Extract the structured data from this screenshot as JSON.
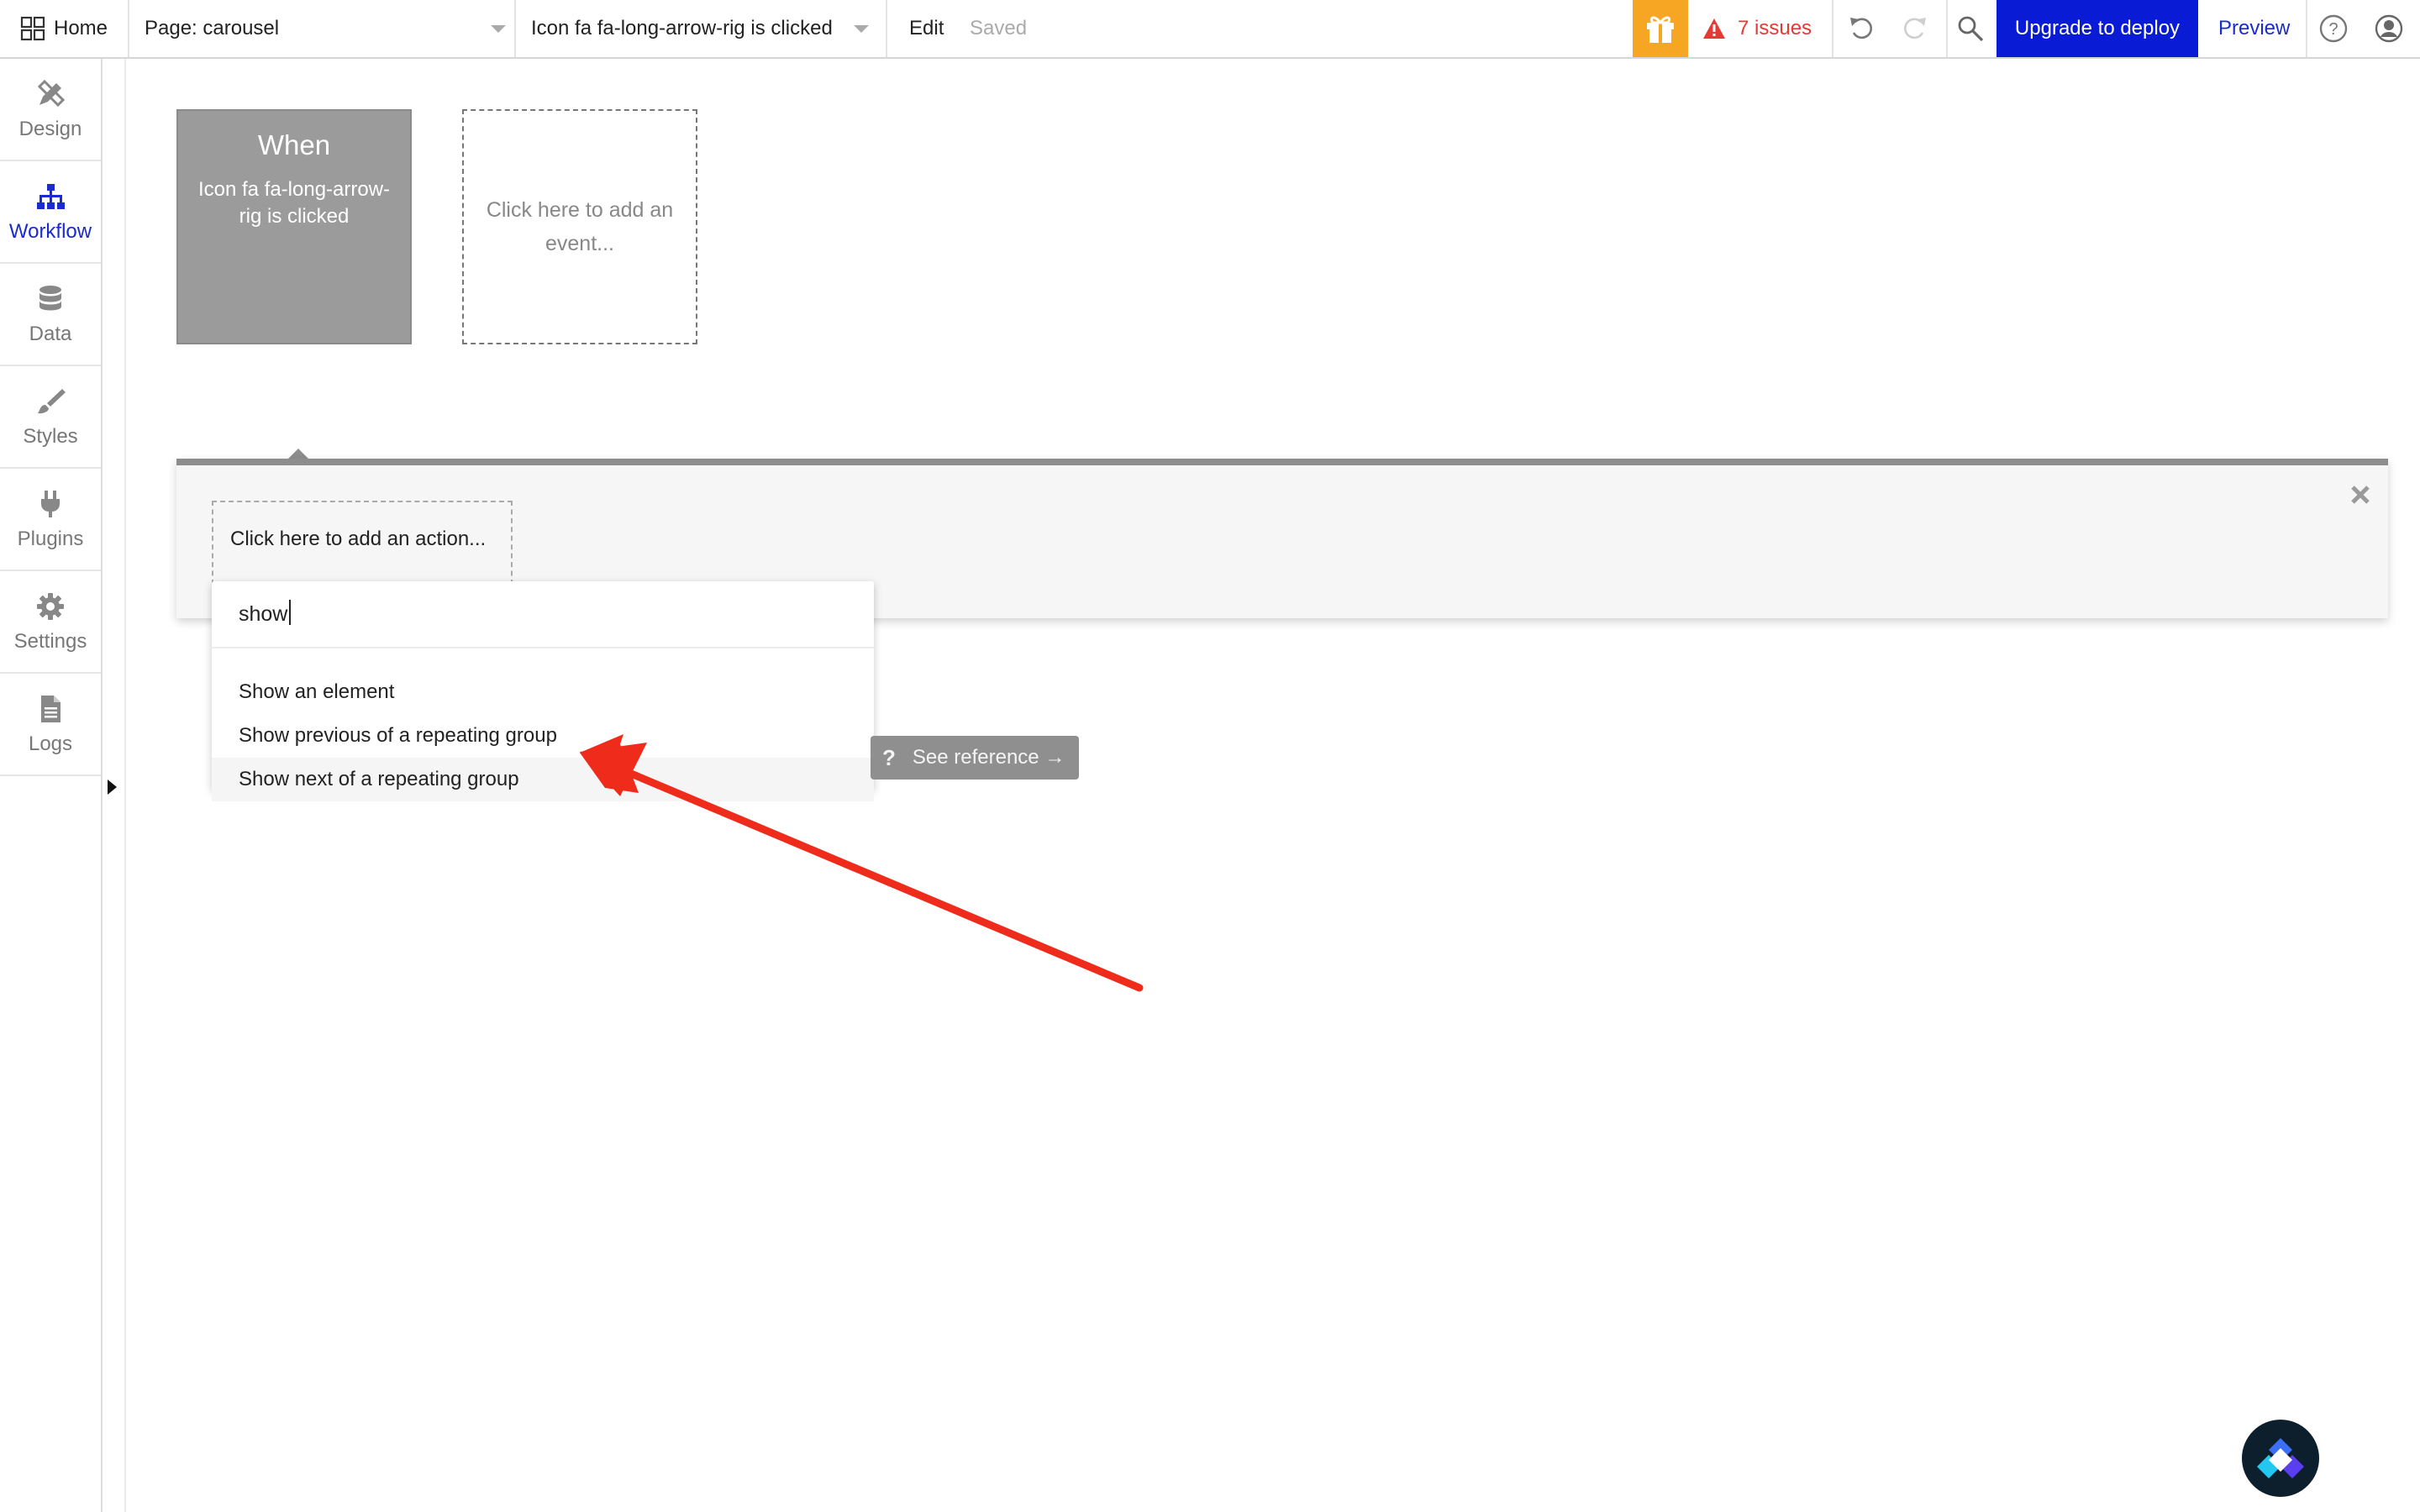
{
  "topbar": {
    "home_label": "Home",
    "page_label": "Page: carousel",
    "event_label": "Icon fa fa-long-arrow-rig is clicked",
    "edit_label": "Edit",
    "saved_label": "Saved",
    "issues_label": "7 issues",
    "upgrade_label": "Upgrade to deploy",
    "preview_label": "Preview"
  },
  "sidebar": {
    "items": [
      {
        "label": "Design",
        "icon": "pencil-ruler-icon"
      },
      {
        "label": "Workflow",
        "icon": "sitemap-icon",
        "active": true
      },
      {
        "label": "Data",
        "icon": "database-icon"
      },
      {
        "label": "Styles",
        "icon": "brush-icon"
      },
      {
        "label": "Plugins",
        "icon": "plug-icon"
      },
      {
        "label": "Settings",
        "icon": "gear-icon"
      },
      {
        "label": "Logs",
        "icon": "document-icon"
      }
    ]
  },
  "workflow": {
    "when_title": "When",
    "when_desc": "Icon fa fa-long-arrow-rig is clicked",
    "add_event_label": "Click here to add an event..."
  },
  "action_panel": {
    "add_action_label": "Click here to add an action..."
  },
  "search": {
    "value": "show"
  },
  "dropdown": {
    "items": [
      "Show an element",
      "Show previous of a repeating group",
      "Show next of a repeating group"
    ],
    "highlighted_index": 2,
    "see_reference_label": "See reference →"
  },
  "colors": {
    "accent": "#1a2bd0",
    "upgrade_bg": "#0a1bd6",
    "gift_bg": "#f6a623",
    "issues": "#e53935",
    "annotation_arrow": "#ef2b1b"
  }
}
